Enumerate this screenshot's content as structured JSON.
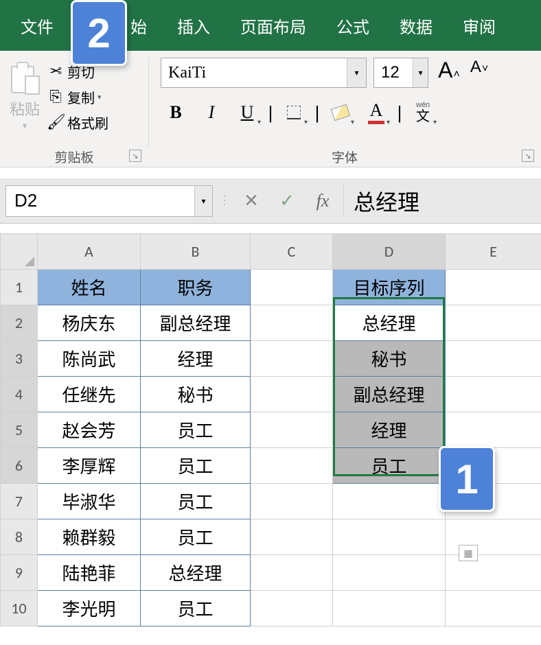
{
  "tabs": {
    "file": "文件",
    "home": "始",
    "insert": "插入",
    "pagelayout": "页面布局",
    "formulas": "公式",
    "data": "数据",
    "review": "审阅"
  },
  "callouts": {
    "c1": "1",
    "c2": "2"
  },
  "clipboard": {
    "paste": "粘贴",
    "cut": "剪切",
    "copy": "复制",
    "formatpainter": "格式刷",
    "group_label": "剪贴板"
  },
  "font": {
    "name": "KaiTi",
    "size": "12",
    "bold": "B",
    "italic": "I",
    "underline": "U",
    "font_color_letter": "A",
    "wen_ruby": "wén",
    "wen_char": "文",
    "group_label": "字体",
    "grow_big": "A",
    "grow_small": "˄",
    "shrink_big": "A",
    "shrink_small": "˅"
  },
  "formula_bar": {
    "name_box": "D2",
    "cancel": "✕",
    "accept": "✓",
    "fx": "fx",
    "value": "总经理"
  },
  "columns": {
    "A": "A",
    "B": "B",
    "C": "C",
    "D": "D",
    "E": "E"
  },
  "rows": {
    "r1": "1",
    "r2": "2",
    "r3": "3",
    "r4": "4",
    "r5": "5",
    "r6": "6",
    "r7": "7",
    "r8": "8",
    "r9": "9",
    "r10": "10"
  },
  "tableAB": {
    "headers": {
      "A": "姓名",
      "B": "职务"
    },
    "rows": [
      {
        "A": "杨庆东",
        "B": "副总经理"
      },
      {
        "A": "陈尚武",
        "B": "经理"
      },
      {
        "A": "任继先",
        "B": "秘书"
      },
      {
        "A": "赵会芳",
        "B": "员工"
      },
      {
        "A": "李厚辉",
        "B": "员工"
      },
      {
        "A": "毕淑华",
        "B": "员工"
      },
      {
        "A": "赖群毅",
        "B": "员工"
      },
      {
        "A": "陆艳菲",
        "B": "总经理"
      },
      {
        "A": "李光明",
        "B": "员工"
      }
    ]
  },
  "tableD": {
    "header": "目标序列",
    "rows": [
      "总经理",
      "秘书",
      "副总经理",
      "经理",
      "员工"
    ]
  },
  "icons": {
    "dropdown": "▾"
  }
}
